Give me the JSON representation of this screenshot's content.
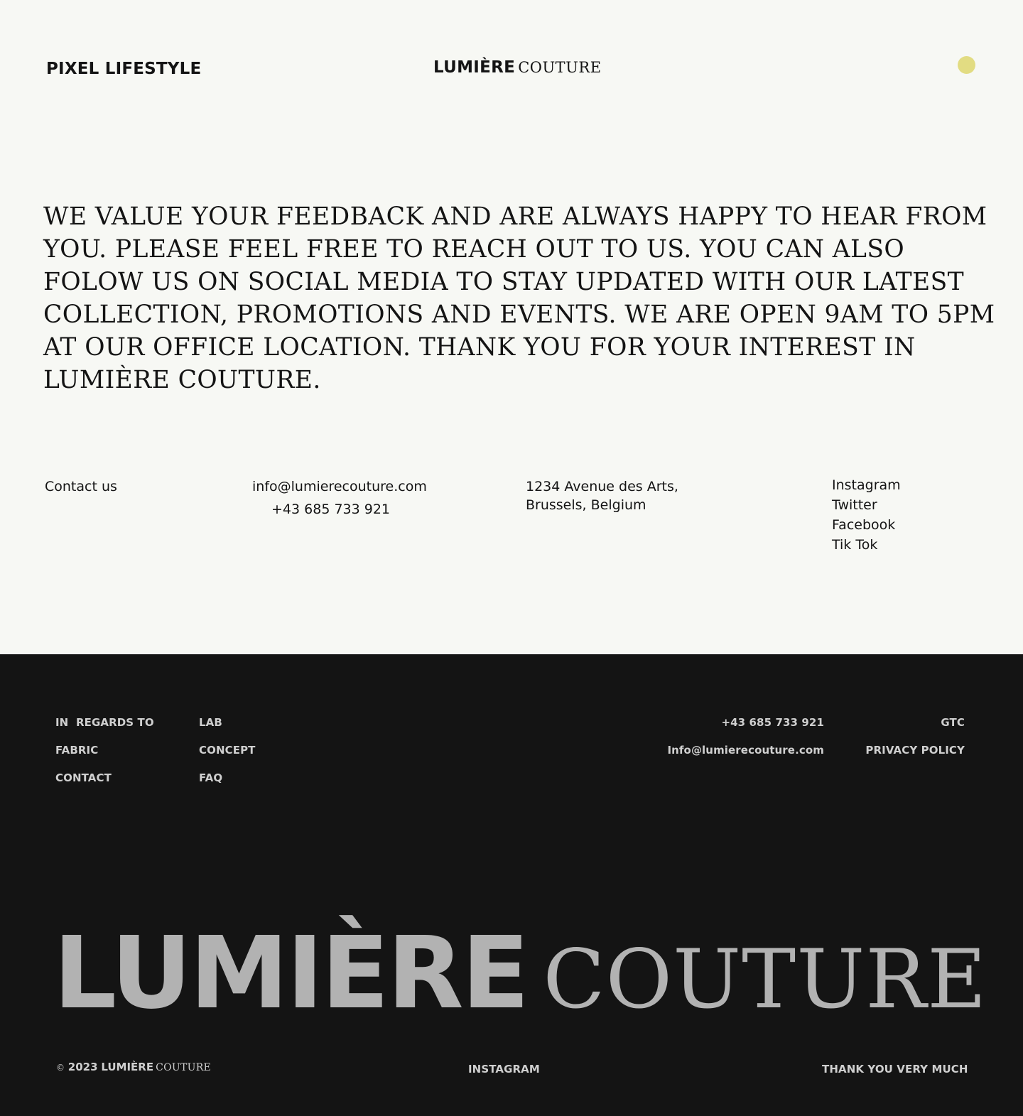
{
  "header": {
    "brand_left": "PIXEL LIFESTYLE",
    "logo_part1": "LUMIÈRE",
    "logo_part2": "COUTURE",
    "accent_dot_color": "#e2dc82"
  },
  "main": {
    "headline": "We value your feedback and are always happy to hear from you. Please feel free to reach out to us. You can also folow us on social media to stay updated with our latest collection, promotions and events. We are open 9am to 5pm at our office location. Thank you for your interest in Lumière Couture."
  },
  "contact": {
    "label": "Contact us",
    "email": "info@lumierecouture.com",
    "phone": "+43 685 733 921",
    "address_line1": "1234 Avenue des Arts,",
    "address_line2": "Brussels, Belgium",
    "social": [
      "Instagram",
      "Twitter",
      "Facebook",
      "Tik Tok"
    ]
  },
  "footer": {
    "col1": [
      "IN  REGARDS TO",
      "FABRIC",
      "CONTACT"
    ],
    "col2": [
      "LAB",
      "CONCEPT",
      "FAQ"
    ],
    "phone": "+43 685 733 921",
    "email": "Info@lumierecouture.com",
    "gtc": "GTC",
    "privacy": "PRIVACY POLICY",
    "big_part1": "LUMIÈRE",
    "big_part2": "COUTURE",
    "copyright_symbol": "©",
    "copyright_year": "2023",
    "copyright_brand1": "LUMIÈRE",
    "copyright_brand2": "COUTURE",
    "instagram": "INSTAGRAM",
    "thanks": "THANK YOU VERY MUCH"
  },
  "colors": {
    "background": "#f7f8f4",
    "footer_bg": "#141414",
    "footer_text": "#cfcfcf",
    "big_logo": "#b2b2b2"
  }
}
